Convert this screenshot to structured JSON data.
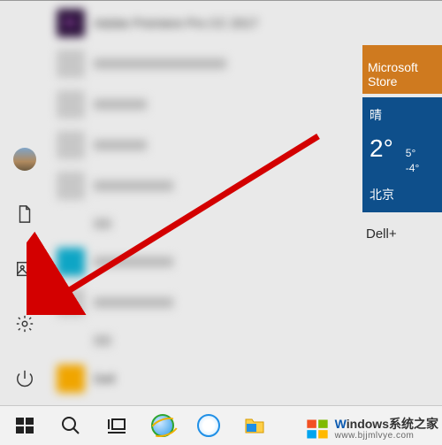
{
  "rail": {
    "account_tooltip": "账户",
    "documents_tooltip": "文档",
    "pictures_tooltip": "图片",
    "settings_tooltip": "设置",
    "power_tooltip": "电源"
  },
  "apps": [
    {
      "name": "Adobe Premiere Pro CC 2017",
      "color": "#6a2e93",
      "accent": "#c95fd0",
      "letters": "Pr"
    },
    {
      "name": "",
      "color": "#c0c0c0"
    },
    {
      "name": "",
      "color": "#c0c0c0"
    },
    {
      "name": "",
      "color": "#c0c0c0"
    },
    {
      "name": "",
      "color": "#c0c0c0"
    },
    {
      "name": "",
      "color": "#c0c0c0"
    },
    {
      "name": "",
      "color": "#0ea5c5"
    },
    {
      "name": "",
      "color": "#c0c0c0"
    },
    {
      "name": "",
      "color": "#f0a500"
    },
    {
      "name": "Dell",
      "color": "#f0a500"
    }
  ],
  "tiles": {
    "store_label": "Microsoft Store",
    "weather": {
      "condition": "晴",
      "temp": "2°",
      "high": "5°",
      "low": "-4°",
      "city": "北京"
    },
    "dell_label": "Dell+"
  },
  "taskbar": {
    "start": "开始",
    "search": "搜索",
    "taskview": "任务视图",
    "ie": "Internet Explorer",
    "browser": "浏览器",
    "explorer": "文件资源管理器"
  },
  "annotation": {
    "arrow_target": "settings"
  },
  "watermark": {
    "brand_w": "W",
    "brand_rest": "indows",
    "brand_cn": "系统之家",
    "url": "www.bjjmlvye.com"
  }
}
